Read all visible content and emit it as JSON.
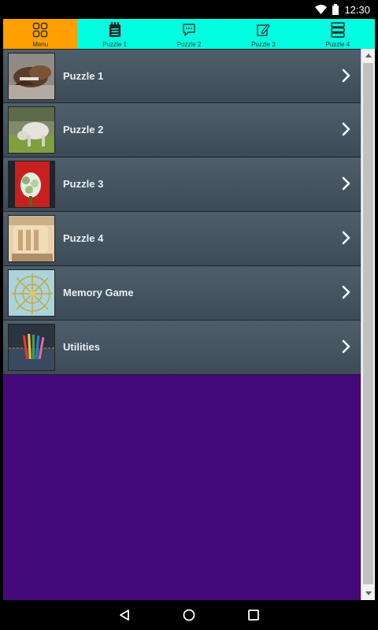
{
  "status": {
    "time": "12:30"
  },
  "tabs": [
    {
      "label": "Menu",
      "icon": "grid-icon",
      "active": true
    },
    {
      "label": "Puzzle 1",
      "icon": "notepad-icon"
    },
    {
      "label": "Puzzle 2",
      "icon": "chat-icon"
    },
    {
      "label": "Puzzle 3",
      "icon": "edit-icon"
    },
    {
      "label": "Puzzle 4",
      "icon": "stack-icon"
    }
  ],
  "menu_items": [
    {
      "label": "Puzzle 1",
      "thumb": "shoes-photo"
    },
    {
      "label": "Puzzle 2",
      "thumb": "goat-photo"
    },
    {
      "label": "Puzzle 3",
      "thumb": "bouquet-photo"
    },
    {
      "label": "Puzzle 4",
      "thumb": "glove-photo"
    },
    {
      "label": "Memory Game",
      "thumb": "pattern-photo"
    },
    {
      "label": "Utilities",
      "thumb": "pencils-photo"
    }
  ],
  "colors": {
    "tab_bar": "#00ffe0",
    "tab_active": "#ffa000",
    "list_bg": "#44097a",
    "item_bg": "#4a5a66"
  }
}
